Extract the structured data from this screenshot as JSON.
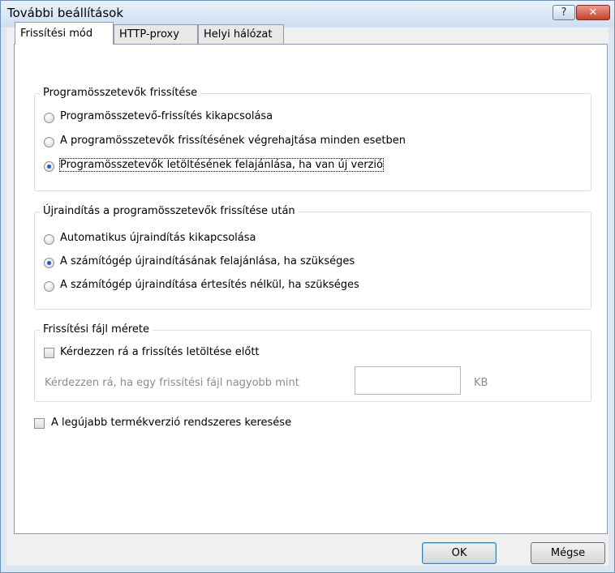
{
  "window": {
    "title": "További beállítások",
    "help_glyph": "?",
    "close_glyph": "✕"
  },
  "tabs": [
    {
      "label": "Frissítési mód",
      "active": true
    },
    {
      "label": "HTTP-proxy",
      "active": false
    },
    {
      "label": "Helyi hálózat",
      "active": false
    }
  ],
  "program_update": {
    "legend": "Programösszetevők frissítése",
    "options": [
      {
        "label": "Programösszetevő-frissítés kikapcsolása",
        "selected": false
      },
      {
        "label": "A programösszetevők frissítésének végrehajtása minden esetben",
        "selected": false
      },
      {
        "label": "Programösszetevők letöltésének felajánlása, ha van új verzió",
        "selected": true
      }
    ]
  },
  "restart": {
    "legend": "Újraindítás a programösszetevők frissítése után",
    "options": [
      {
        "label": "Automatikus újraindítás kikapcsolása",
        "selected": false
      },
      {
        "label": "A számítógép újraindításának felajánlása, ha szükséges",
        "selected": true
      },
      {
        "label": "A számítógép újraindítása értesítés nélkül, ha szükséges",
        "selected": false
      }
    ]
  },
  "file_size": {
    "legend": "Frissítési fájl mérete",
    "ask_label": "Kérdezzen rá a frissítés letöltése előtt",
    "ask_checked": false,
    "threshold_label": "Kérdezzen rá, ha egy frissítési fájl nagyobb mint",
    "threshold_value": "",
    "unit": "KB"
  },
  "check_latest": {
    "label": "A legújabb termékverzió rendszeres keresése",
    "checked": false
  },
  "buttons": {
    "ok": "OK",
    "cancel": "Mégse"
  }
}
